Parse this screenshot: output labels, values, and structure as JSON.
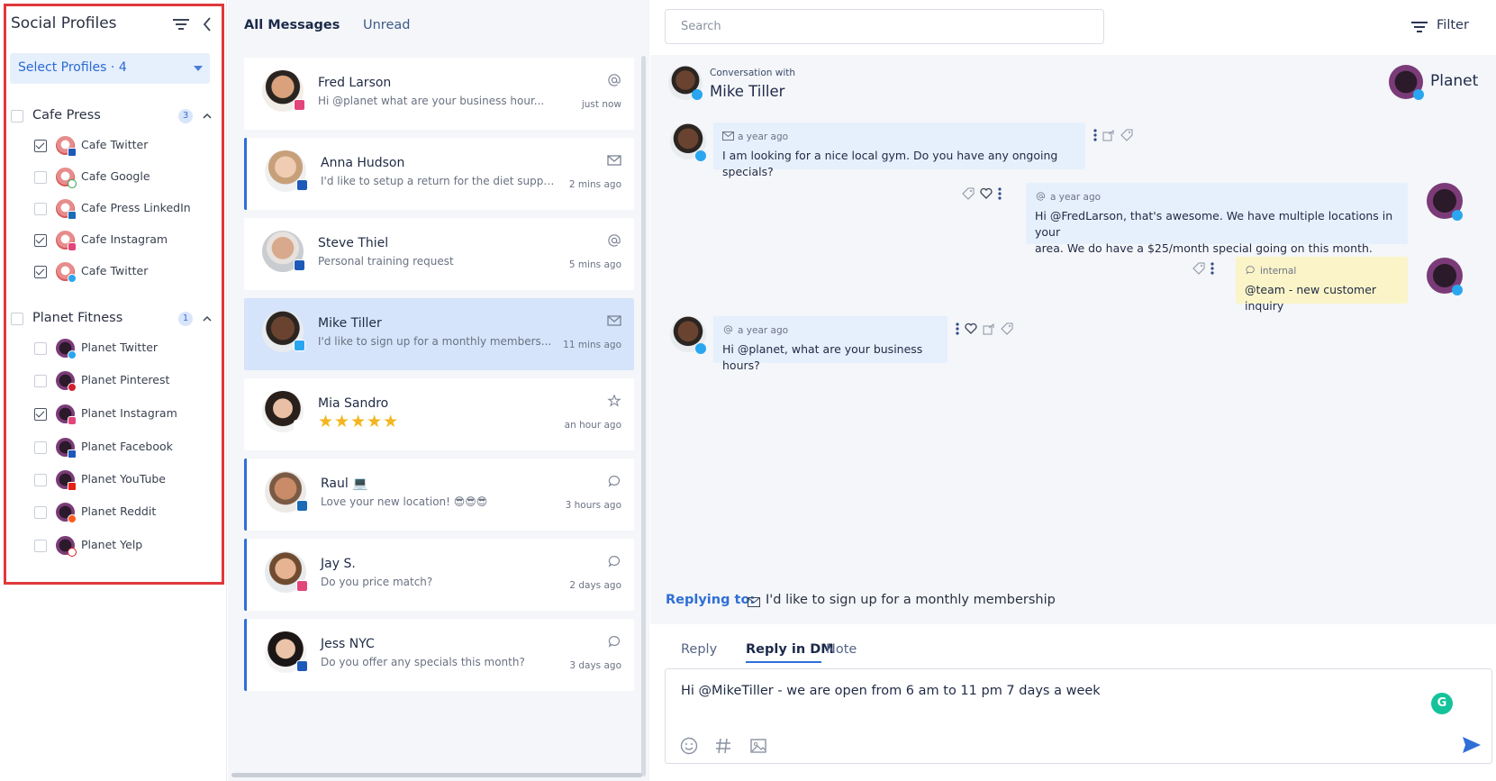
{
  "sidebar": {
    "title": "Social Profiles",
    "select_label": "Select Profiles · 4",
    "groups": [
      {
        "name": "Cafe Press",
        "count": "3",
        "profiles": [
          {
            "name": "Cafe Twitter",
            "checked": true,
            "network": "facebook"
          },
          {
            "name": "Cafe Google",
            "checked": false,
            "network": "google"
          },
          {
            "name": "Cafe Press LinkedIn",
            "checked": false,
            "network": "linkedin"
          },
          {
            "name": "Cafe Instagram",
            "checked": true,
            "network": "instagram"
          },
          {
            "name": "Cafe Twitter",
            "checked": true,
            "network": "twitter"
          }
        ]
      },
      {
        "name": "Planet Fitness",
        "count": "1",
        "profiles": [
          {
            "name": "Planet Twitter",
            "checked": false,
            "network": "twitter"
          },
          {
            "name": "Planet Pinterest",
            "checked": false,
            "network": "pinterest"
          },
          {
            "name": "Planet Instagram",
            "checked": true,
            "network": "instagram"
          },
          {
            "name": "Planet Facebook",
            "checked": false,
            "network": "facebook"
          },
          {
            "name": "Planet YouTube",
            "checked": false,
            "network": "youtube"
          },
          {
            "name": "Planet Reddit",
            "checked": false,
            "network": "reddit"
          },
          {
            "name": "Planet Yelp",
            "checked": false,
            "network": "yelp"
          }
        ]
      }
    ]
  },
  "list": {
    "tabs": [
      "All Messages",
      "Unread"
    ],
    "messages": [
      {
        "name": "Fred Larson",
        "text": "Hi @planet what are your business hour...",
        "time": "just now",
        "icon": "at-icon",
        "network": "instagram"
      },
      {
        "name": "Anna Hudson",
        "text": "I'd like to setup a return for the diet suppl...",
        "time": "2 mins ago",
        "icon": "mail-icon",
        "network": "facebook"
      },
      {
        "name": "Steve Thiel",
        "text": "Personal training request",
        "time": "5 mins ago",
        "icon": "at-icon",
        "network": "facebook"
      },
      {
        "name": "Mike Tiller",
        "text": "I'd like to sign up for a monthly members...",
        "time": "11 mins ago",
        "icon": "mail-icon",
        "network": "twitter"
      },
      {
        "name": "Mia Sandro",
        "stars": "★★★★★",
        "time": "an hour ago",
        "icon": "star-list-icon",
        "network": "google"
      },
      {
        "name": "Raul 💻",
        "text": "Love your new location! 😎😎😎",
        "time": "3 hours ago",
        "icon": "comment-icon",
        "network": "linkedin"
      },
      {
        "name": "Jay S.",
        "text": "Do you price match?",
        "time": "2 days ago",
        "icon": "comment-icon",
        "network": "instagram"
      },
      {
        "name": "Jess NYC",
        "text": "Do you offer any specials this month?",
        "time": "3 days ago",
        "icon": "comment-icon",
        "network": "facebook"
      }
    ]
  },
  "conversation": {
    "search_placeholder": "Search",
    "filter_label": "Filter",
    "subtitle": "Conversation with",
    "contact": "Mike Tiller",
    "brand": "Planet",
    "thread": [
      {
        "meta": "a year ago",
        "text": "I am looking for a nice local gym. Do you have any ongoing specials?"
      },
      {
        "meta": "a year ago",
        "text_line1": "Hi @FredLarson, that's awesome. We have multiple locations in your",
        "text_line2": "area. We do have a $25/month special going on this month."
      },
      {
        "meta": "internal",
        "text": "@team - new customer inquiry"
      },
      {
        "meta": "a year ago",
        "text": "Hi @planet, what are your business hours?"
      }
    ],
    "replying_label": "Replying to:",
    "replying_text": "I'd like to sign up for a monthly membership",
    "reply_tabs": [
      "Reply",
      "Reply in DM",
      "Note"
    ],
    "composer_text": "Hi @MikeTiller - we are open from 6 am to 11 pm 7 days a week",
    "grammarly": "G"
  },
  "colors": {
    "accent": "#2f6fd6",
    "highlight_box": "#e0383b",
    "selected_row": "#d5e4fa",
    "bubble": "#e6effc",
    "note_bubble": "#fbf4c8"
  }
}
